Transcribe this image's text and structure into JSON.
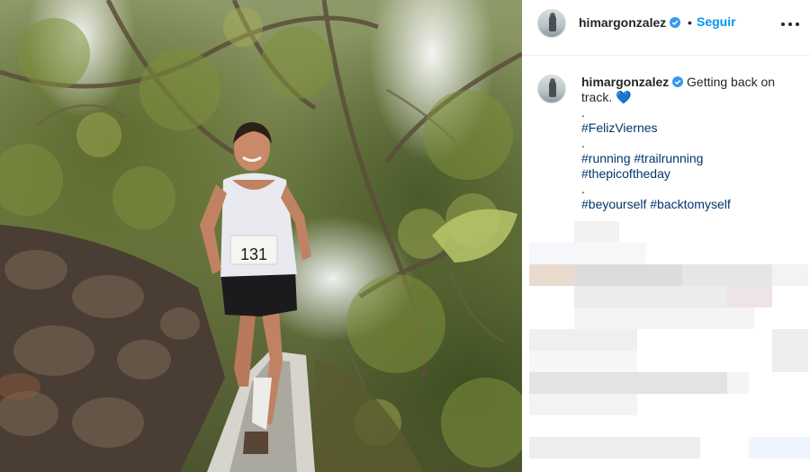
{
  "header": {
    "username": "himargonzalez",
    "separator": "•",
    "follow_label": "Seguir",
    "verified_icon": "verified-badge-icon",
    "more_icon": "more-options-icon"
  },
  "caption": {
    "username": "himargonzalez",
    "text_line1": "Getting back on",
    "text_line2": "track.",
    "heart": "💙",
    "lines": [
      ".",
      "#FelizViernes",
      ".",
      "#running #trailrunning",
      "#thepicoftheday",
      ".",
      "#beyourself #backtomyself"
    ]
  },
  "photo": {
    "bib_number": "131"
  },
  "colors": {
    "link": "#0095f6",
    "hashtag": "#00376b",
    "verified": "#3897f0"
  }
}
